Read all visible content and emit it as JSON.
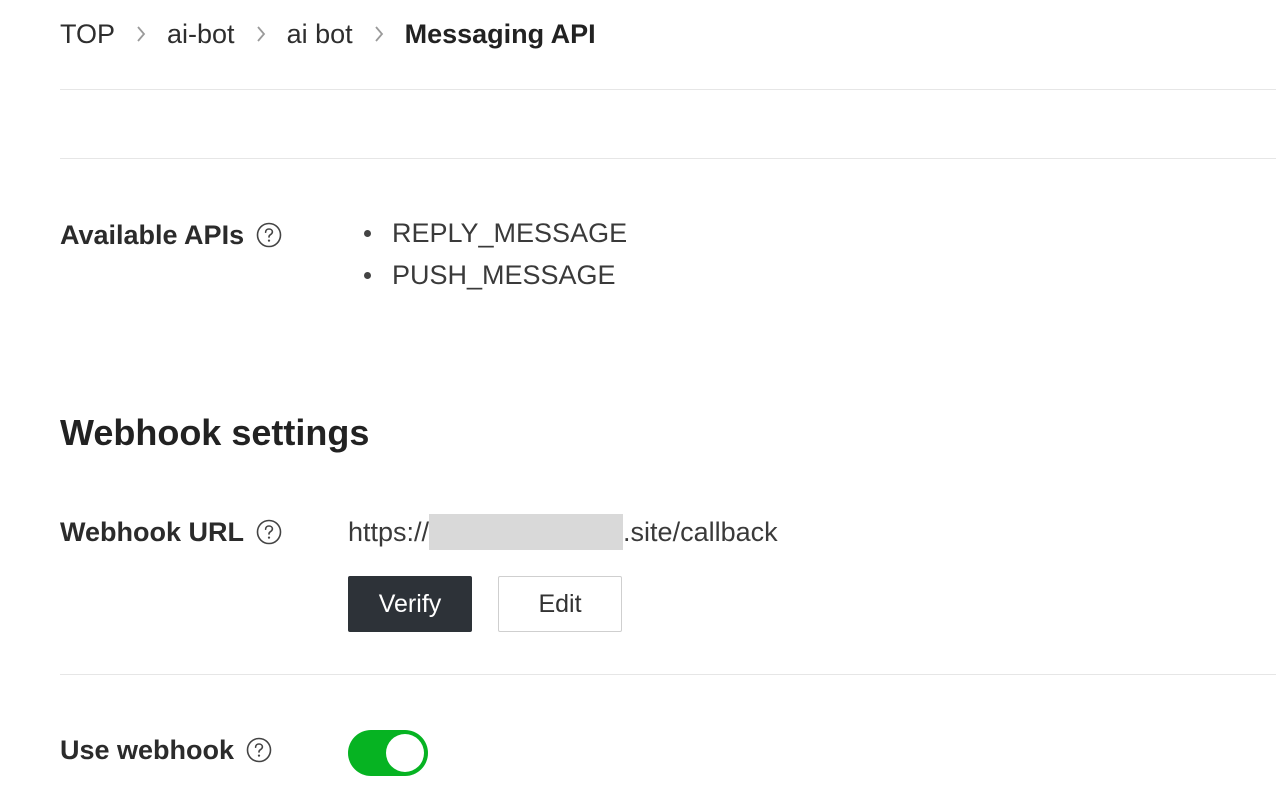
{
  "breadcrumb": {
    "items": [
      {
        "label": "TOP"
      },
      {
        "label": "ai-bot"
      },
      {
        "label": "ai bot"
      },
      {
        "label": "Messaging API"
      }
    ]
  },
  "available_apis": {
    "label": "Available APIs",
    "help_icon": "question-circle-icon",
    "items": [
      "REPLY_MESSAGE",
      "PUSH_MESSAGE"
    ]
  },
  "webhook_settings": {
    "title": "Webhook settings",
    "webhook_url": {
      "label": "Webhook URL",
      "help_icon": "question-circle-icon",
      "value_prefix": "https://",
      "value_suffix": ".site/callback"
    },
    "verify_label": "Verify",
    "edit_label": "Edit",
    "use_webhook": {
      "label": "Use webhook",
      "help_icon": "question-circle-icon",
      "enabled": true
    }
  },
  "colors": {
    "toggle_on": "#06b322",
    "verify_button": "#2d3238",
    "divider": "#e6e6e6"
  }
}
